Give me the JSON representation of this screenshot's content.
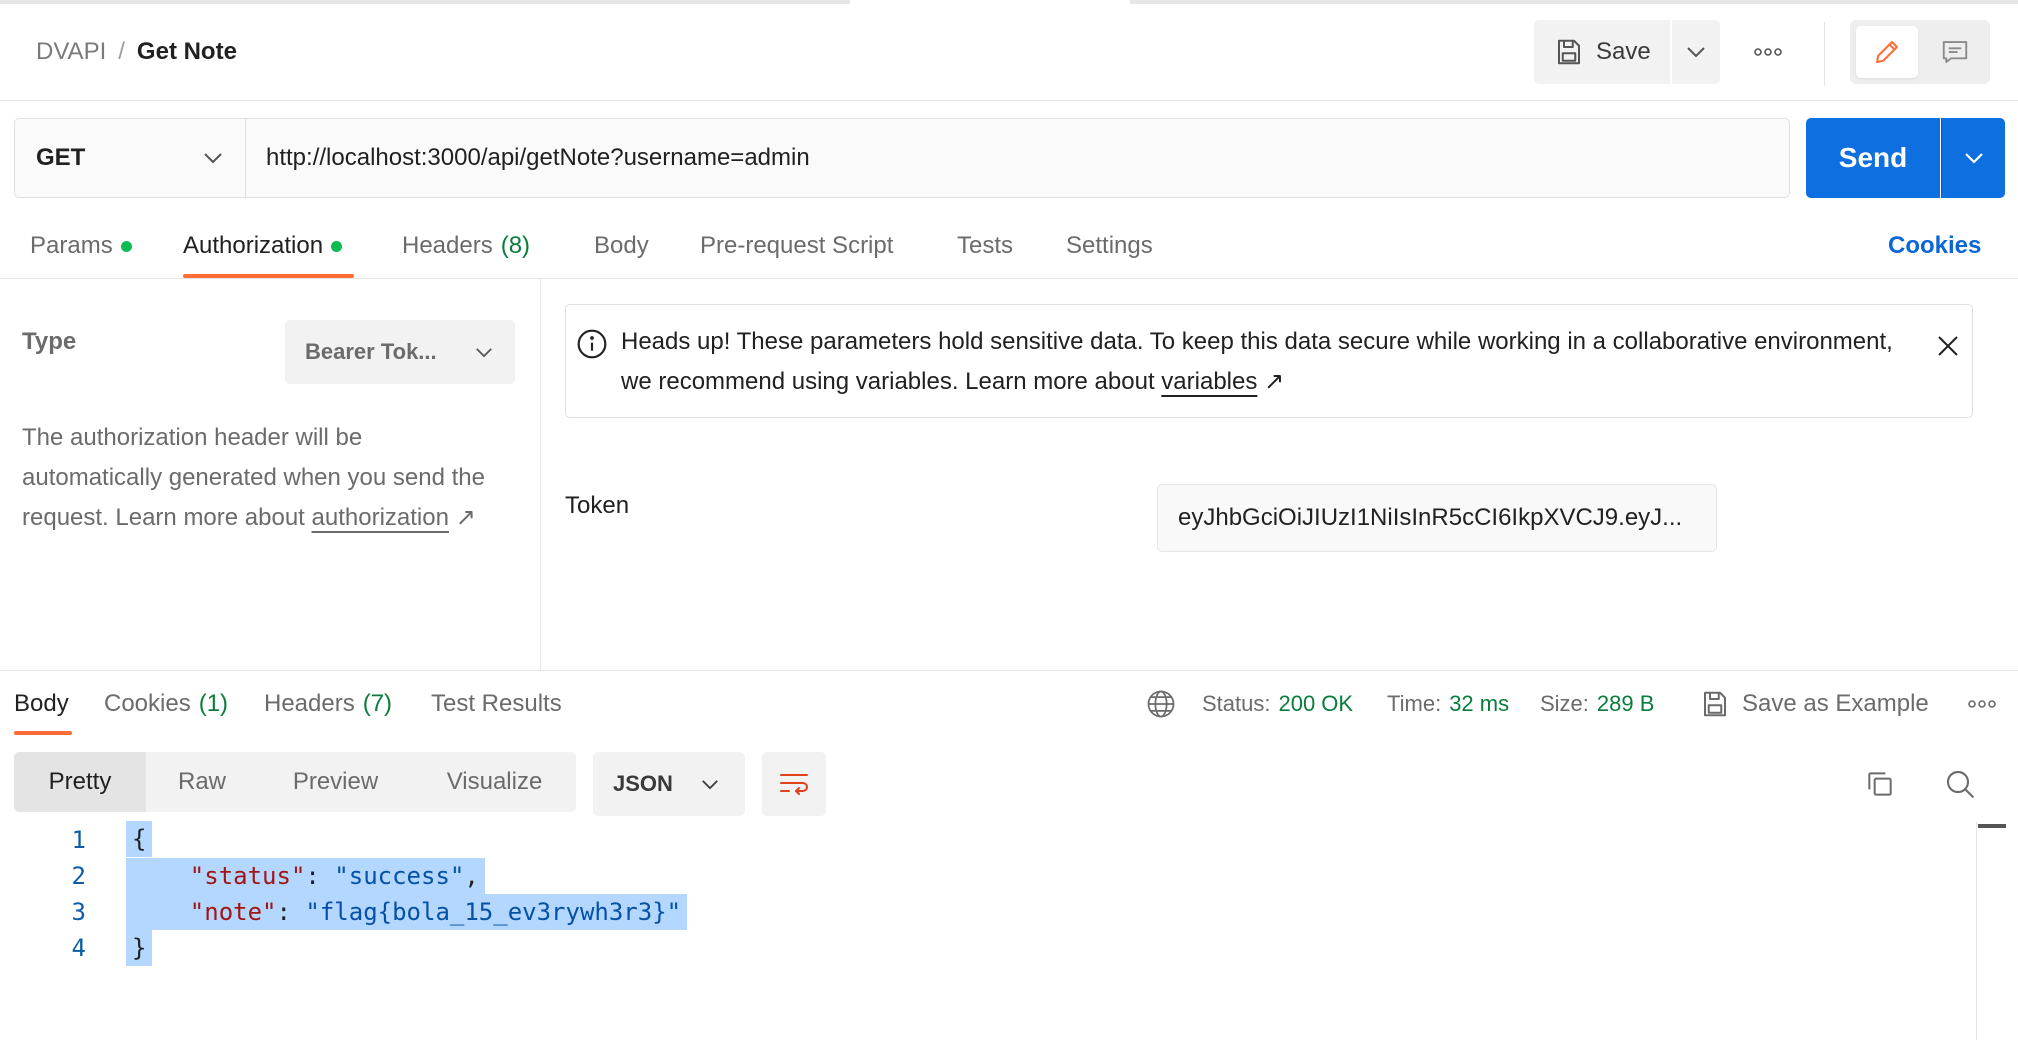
{
  "header": {
    "workspace": "DVAPI",
    "separator": "/",
    "request_name": "Get Note",
    "save_label": "Save"
  },
  "request": {
    "method": "GET",
    "url": "http://localhost:3000/api/getNote?username=admin",
    "send_label": "Send"
  },
  "request_tabs": {
    "params": "Params",
    "authorization": "Authorization",
    "headers": "Headers",
    "headers_count": "(8)",
    "body": "Body",
    "prerequest": "Pre-request Script",
    "tests": "Tests",
    "settings": "Settings",
    "cookies": "Cookies"
  },
  "auth": {
    "type_label": "Type",
    "type_value": "Bearer Tok...",
    "description": "The authorization header will be automatically generated when you send the request. Learn more about",
    "link": "authorization",
    "link_arrow": "↗",
    "banner_text": "Heads up! These parameters hold sensitive data. To keep this data secure while working in a collaborative environment, we recommend using variables. Learn more about",
    "banner_link": "variables",
    "banner_arrow": "↗",
    "token_label": "Token",
    "token_value": "eyJhbGciOiJIUzI1NiIsInR5cCI6IkpXVCJ9.eyJ..."
  },
  "response_tabs": {
    "body": "Body",
    "cookies": "Cookies",
    "cookies_count": "(1)",
    "headers": "Headers",
    "headers_count": "(7)",
    "test_results": "Test Results"
  },
  "response_meta": {
    "status_label": "Status:",
    "status_value": "200 OK",
    "time_label": "Time:",
    "time_value": "32 ms",
    "size_label": "Size:",
    "size_value": "289 B",
    "save_example": "Save as Example"
  },
  "response_view": {
    "pretty": "Pretty",
    "raw": "Raw",
    "preview": "Preview",
    "visualize": "Visualize",
    "format": "JSON"
  },
  "response_body": {
    "lines": [
      {
        "n": "1",
        "open": "{"
      },
      {
        "n": "2",
        "key": "\"status\"",
        "value": "\"success\"",
        "trail": ","
      },
      {
        "n": "3",
        "key": "\"note\"",
        "value": "\"flag{bola_15_ev3rywh3r3}\"",
        "trail": ""
      },
      {
        "n": "4",
        "close": "}"
      }
    ]
  },
  "colors": {
    "accent_orange": "#ff6c37",
    "send_blue": "#0d6fe0",
    "status_green": "#0a7c3b",
    "dot_green": "#0cbb52",
    "selection": "#b3d7ff"
  }
}
